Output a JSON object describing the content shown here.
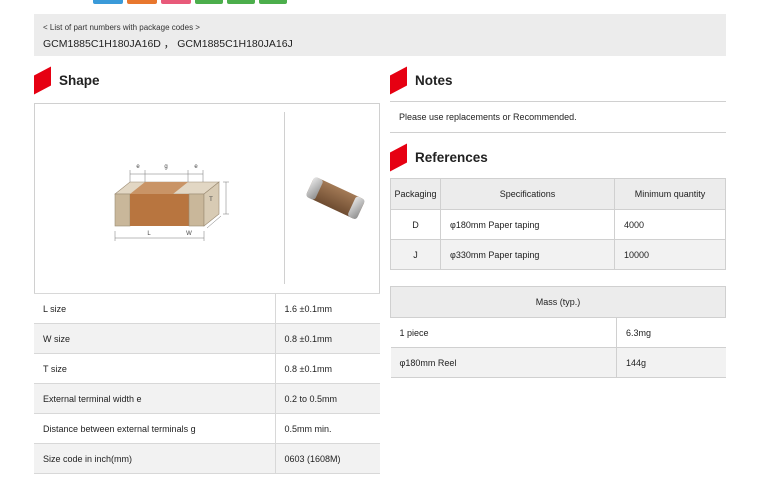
{
  "top_buttons": {
    "colors": [
      "#3a9ad9",
      "#e8772e",
      "#e85a7a",
      "#4cae4c",
      "#4cae4c",
      "#4cae4c"
    ]
  },
  "part_numbers": {
    "link_label": "< List of part numbers with package codes >",
    "values": "GCM1885C1H180JA16D ， GCM1885C1H180JA16J"
  },
  "shape": {
    "title": "Shape",
    "diagram_labels": {
      "e1": "e",
      "g": "g",
      "e2": "e",
      "t": "T",
      "w": "W",
      "l": "L"
    },
    "rows": [
      {
        "label": "L size",
        "value": "1.6 ±0.1mm"
      },
      {
        "label": "W size",
        "value": "0.8 ±0.1mm"
      },
      {
        "label": "T size",
        "value": "0.8 ±0.1mm"
      },
      {
        "label": "External terminal width e",
        "value": "0.2 to 0.5mm"
      },
      {
        "label": "Distance between external terminals g",
        "value": "0.5mm min."
      },
      {
        "label": "Size code in inch(mm)",
        "value": "0603 (1608M)"
      }
    ]
  },
  "notes": {
    "title": "Notes",
    "text": "Please use replacements or Recommended."
  },
  "references": {
    "title": "References",
    "headers": [
      "Packaging",
      "Specifications",
      "Minimum quantity"
    ],
    "rows": [
      {
        "packaging": "D",
        "spec": "φ180mm Paper taping",
        "qty": "4000"
      },
      {
        "packaging": "J",
        "spec": "φ330mm Paper taping",
        "qty": "10000"
      }
    ]
  },
  "mass": {
    "header": "Mass (typ.)",
    "rows": [
      {
        "label": "1 piece",
        "value": "6.3mg"
      },
      {
        "label": "φ180mm Reel",
        "value": "144g"
      }
    ]
  },
  "colors": {
    "accent": "#e60012",
    "capacitor_body": "#b8753f",
    "terminal": "#c9b79a"
  }
}
